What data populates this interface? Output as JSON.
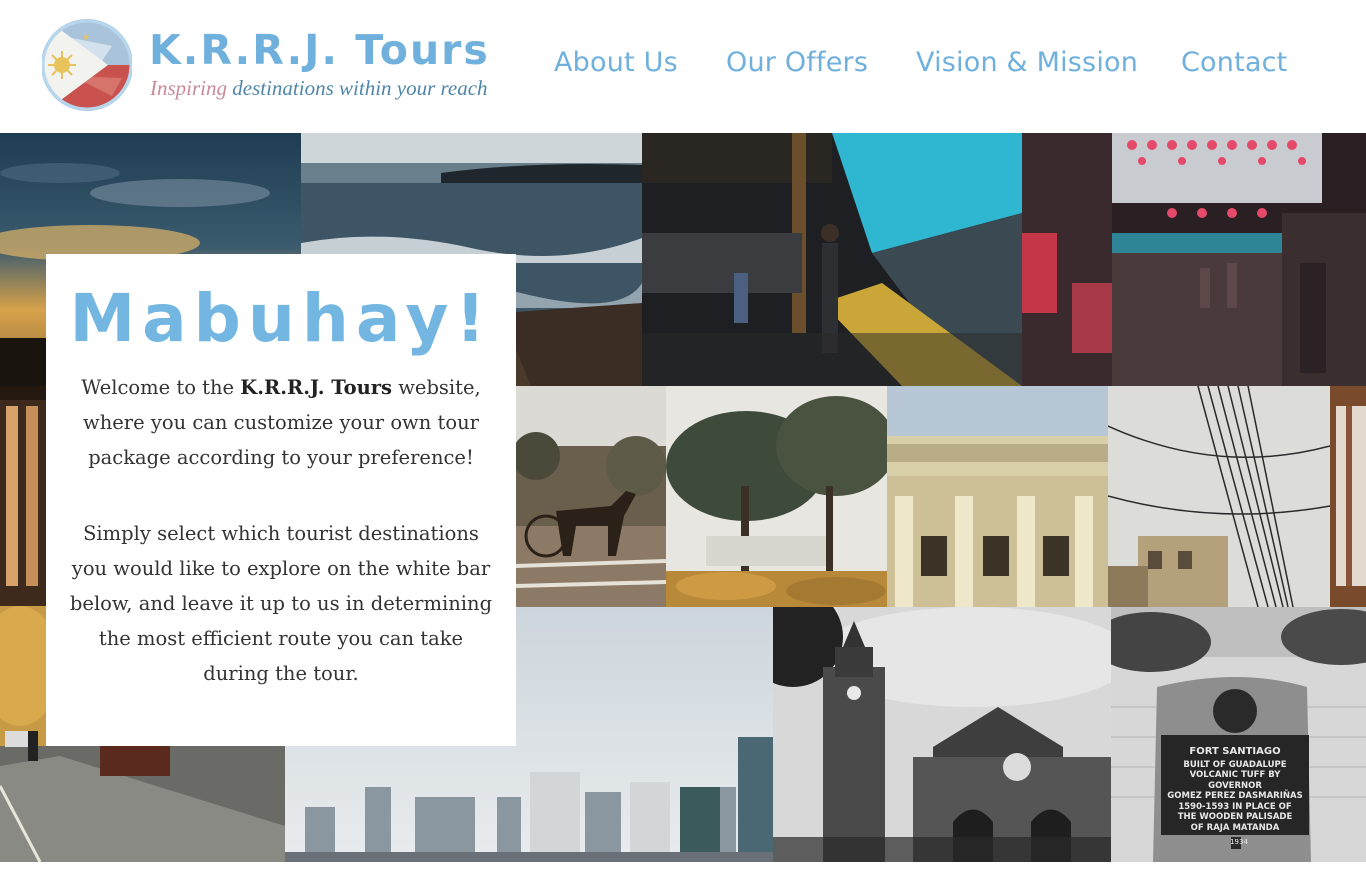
{
  "brand": {
    "name": "K.R.R.J. Tours",
    "tagline_accent": "Inspiring",
    "tagline_rest": " destinations within your reach"
  },
  "nav": {
    "items": [
      {
        "label": "About Us"
      },
      {
        "label": "Our Offers"
      },
      {
        "label": "Vision & Mission"
      },
      {
        "label": "Contact"
      }
    ]
  },
  "welcome": {
    "title": "Mabuhay!",
    "p1_before": "Welcome to the ",
    "p1_brand": "K.R.R.J. Tours",
    "p1_after": " website, where you can customize your own tour package according to your preference!",
    "p2": "Simply select which tourist destinations you would like to explore on the white bar below, and leave it up to us in determining the most efficient route you can take during the tour."
  },
  "photos": {
    "fort_sign": {
      "title": "FORT SANTIAGO",
      "lines": [
        "BUILT OF GUADALUPE",
        "VOLCANIC TUFF BY GOVERNOR",
        "GOMEZ PEREZ DASMARIÑAS",
        "1590-1593 IN PLACE OF",
        "THE WOODEN PALISADE",
        "OF RAJA MATANDA"
      ],
      "year": "1934"
    }
  },
  "colors": {
    "brand_blue": "#6fb0dc",
    "tagline_blue": "#4f86a9",
    "tagline_pink": "#c98a99"
  }
}
